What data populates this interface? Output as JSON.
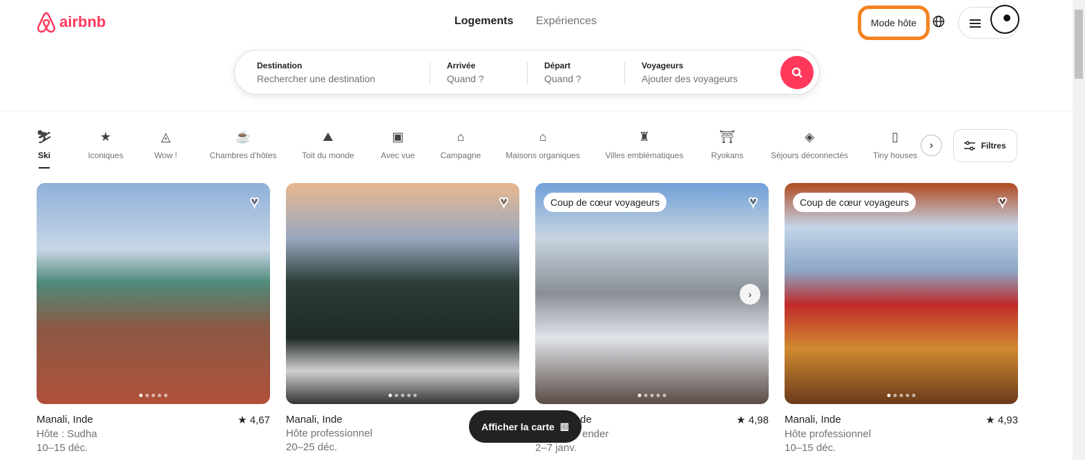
{
  "header": {
    "logo": "airbnb",
    "tabs": [
      "Logements",
      "Expériences"
    ],
    "host_mode": "Mode hôte",
    "accent": "#ff385c"
  },
  "search": {
    "fields": [
      {
        "label": "Destination",
        "placeholder": "Rechercher une destination"
      },
      {
        "label": "Arrivée",
        "placeholder": "Quand ?"
      },
      {
        "label": "Départ",
        "placeholder": "Quand ?"
      },
      {
        "label": "Voyageurs",
        "placeholder": "Ajouter des voyageurs"
      }
    ]
  },
  "categories": [
    {
      "label": "Ski",
      "icon": "ski-icon"
    },
    {
      "label": "Iconiques",
      "icon": "ticket-icon"
    },
    {
      "label": "Wow !",
      "icon": "ufo-icon"
    },
    {
      "label": "Chambres d'hôtes",
      "icon": "mug-icon"
    },
    {
      "label": "Toit du monde",
      "icon": "mountain-flag-icon"
    },
    {
      "label": "Avec vue",
      "icon": "picture-icon"
    },
    {
      "label": "Campagne",
      "icon": "countryside-icon"
    },
    {
      "label": "Maisons organiques",
      "icon": "organic-house-icon"
    },
    {
      "label": "Villes emblématiques",
      "icon": "tower-icon"
    },
    {
      "label": "Ryokans",
      "icon": "ryokan-icon"
    },
    {
      "label": "Séjours déconnectés",
      "icon": "diamond-icon"
    },
    {
      "label": "Tiny houses",
      "icon": "tiny-house-icon"
    }
  ],
  "filters_label": "Filtres",
  "listings": [
    {
      "title": "Manali, Inde",
      "rating": "4,67",
      "host": "Hôte : Sudha",
      "dates": "10–15 déc.",
      "badge": ""
    },
    {
      "title": "Manali, Inde",
      "rating": "",
      "host": "Hôte professionnel",
      "dates": "20–25 déc.",
      "badge": ""
    },
    {
      "title": "Manali, Inde",
      "rating": "4,98",
      "host": "ender",
      "dates": "2–7 janv.",
      "badge": "Coup de cœur voyageurs"
    },
    {
      "title": "Manali, Inde",
      "rating": "4,93",
      "host": "Hôte professionnel",
      "dates": "10–15 déc.",
      "badge": "Coup de cœur voyageurs"
    }
  ],
  "map_button": "Afficher la carte"
}
